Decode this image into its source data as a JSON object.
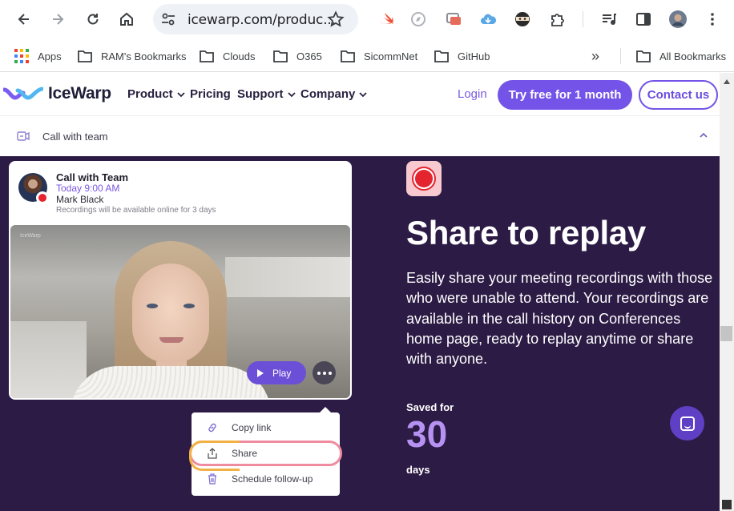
{
  "browser": {
    "url": "icewarp.com/produc...",
    "bookmarks": [
      "Apps",
      "RAM's Bookmarks",
      "Clouds",
      "O365",
      "SicommNet",
      "GitHub"
    ],
    "all_bookmarks": "All Bookmarks",
    "overflow": "»"
  },
  "site": {
    "brand": "IceWarp",
    "nav": [
      "Product",
      "Pricing",
      "Support",
      "Company"
    ],
    "login": "Login",
    "cta": "Try free for 1 month",
    "contact": "Contact us"
  },
  "accordion": {
    "label": "Call with team"
  },
  "card": {
    "title": "Call with Team",
    "time": "Today 9:00 AM",
    "person": "Mark Black",
    "note": "Recordings will be available online for 3 days",
    "play": "Play",
    "video_brand": "IceWarp"
  },
  "menu": [
    "Copy link",
    "Share",
    "Schedule follow-up"
  ],
  "hero": {
    "headline": "Share to replay",
    "body": "Easily share your meeting recordings with those who were unable to attend. Your recordings are available in the call history on Conferences home page, ready to replay anytime or share with anyone.",
    "saved_for": "Saved for",
    "count": "30",
    "unit": "days"
  },
  "colors": {
    "accent": "#7454e8",
    "hero_bg": "#2c1b45",
    "record_red": "#e4252f",
    "counter": "#b692f2"
  }
}
